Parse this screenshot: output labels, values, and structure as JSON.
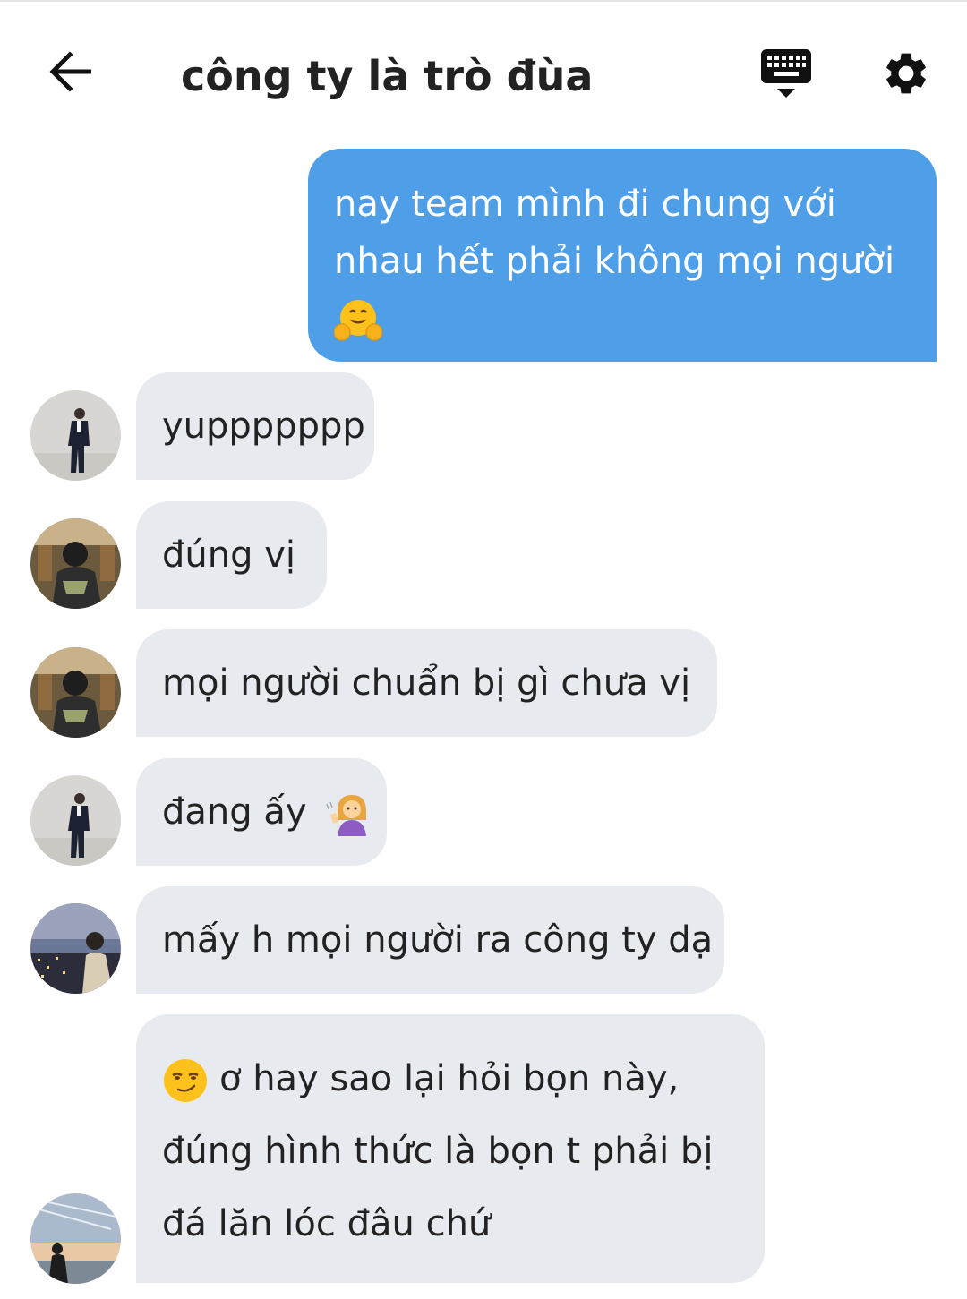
{
  "header": {
    "title": "công ty là trò đùa",
    "back_icon": "arrow-left-icon",
    "keyboard_icon": "keyboard-icon",
    "settings_icon": "gear-icon"
  },
  "colors": {
    "outgoing_bubble": "#4f9fe8",
    "incoming_bubble": "#e7ebf0",
    "text": "#222222"
  },
  "messages": [
    {
      "direction": "out",
      "lines": [
        "nay team mình đi chung với",
        "nhau hết phải không mọi người"
      ],
      "emoji": "hugging-face-emoji"
    },
    {
      "direction": "in",
      "avatar": "avatar-suit-man",
      "lines": [
        "yuppppppp"
      ]
    },
    {
      "direction": "in",
      "avatar": "avatar-hooded-cafe",
      "lines": [
        "đúng vị"
      ]
    },
    {
      "direction": "in",
      "avatar": "avatar-hooded-cafe",
      "lines": [
        "mọi người chuẩn bị gì chưa vị"
      ]
    },
    {
      "direction": "in",
      "avatar": "avatar-suit-man",
      "lines": [
        "đang ấy"
      ],
      "emoji": "person-tipping-hand-emoji"
    },
    {
      "direction": "in",
      "avatar": "avatar-city-night",
      "lines": [
        "mấy h mọi người ra công ty dạ"
      ]
    },
    {
      "direction": "in",
      "avatar": "avatar-sunset-sky",
      "lead_emoji": "smirking-face-emoji",
      "lines": [
        "ơ hay sao lại hỏi bọn này,",
        "đúng hình thức là bọn t phải bị",
        "đá lăn lóc đâu chứ"
      ]
    }
  ]
}
